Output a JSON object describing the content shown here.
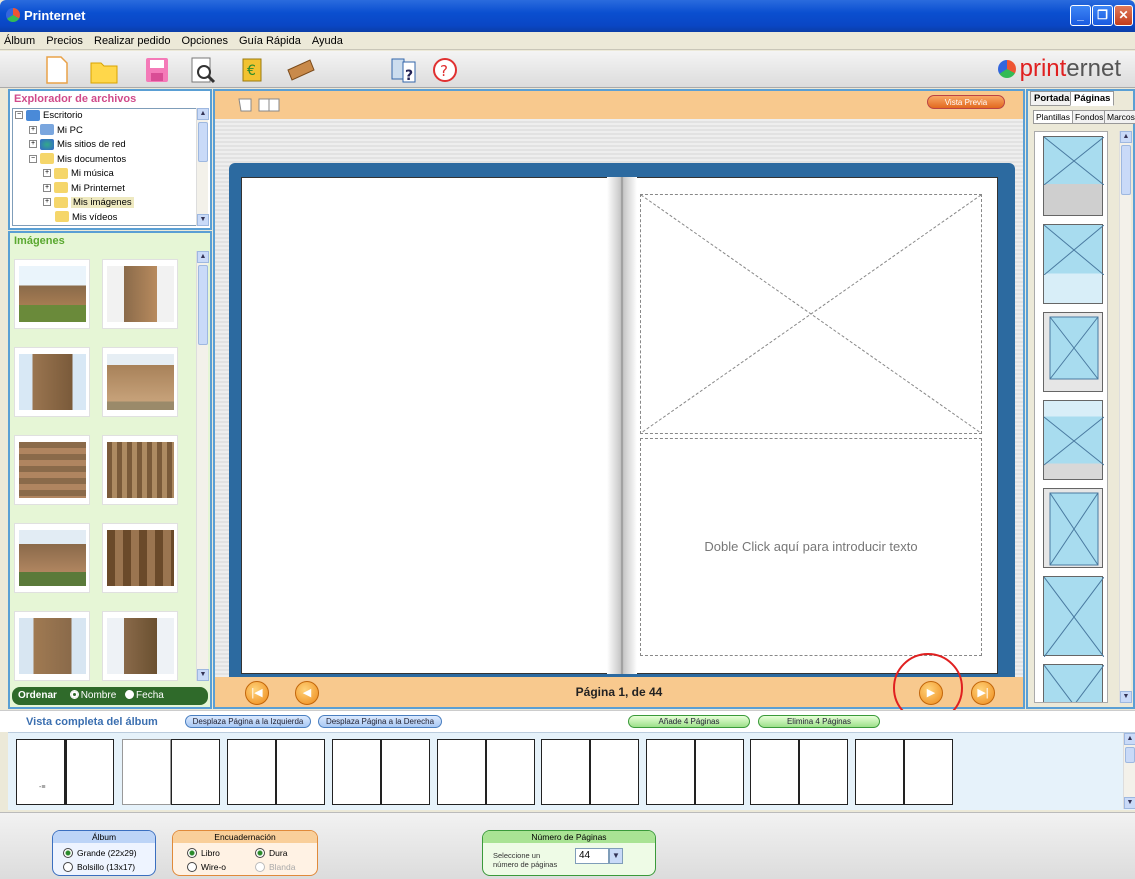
{
  "window": {
    "title": "Printernet"
  },
  "menu": [
    "Álbum",
    "Precios",
    "Realizar pedido",
    "Opciones",
    "Guía Rápida",
    "Ayuda"
  ],
  "toolbar": {
    "icons": [
      "new-document-icon",
      "open-folder-icon",
      "save-icon",
      "print-preview-icon",
      "price-icon",
      "order-icon",
      "quick-guide-icon",
      "help-icon"
    ]
  },
  "logo": {
    "prefix": "print",
    "suffix": "ernet"
  },
  "explorer": {
    "title": "Explorador de archivos",
    "items": [
      {
        "label": "Escritorio"
      },
      {
        "label": "Mi PC"
      },
      {
        "label": "Mis sitios de red"
      },
      {
        "label": "Mis documentos"
      },
      {
        "label": "Mi música"
      },
      {
        "label": "Mi Printernet"
      },
      {
        "label": "Mis imágenes"
      },
      {
        "label": "Mis vídeos"
      }
    ]
  },
  "images_panel": {
    "title": "Imágenes",
    "sort_label": "Ordenar",
    "sort_name": "Nombre",
    "sort_date": "Fecha",
    "thumbnails": 10
  },
  "editor": {
    "preview_button": "Vista Previa",
    "text_placeholder": "Doble Click aquí para introducir texto",
    "page_info": "Página 1, de 44"
  },
  "right_panel": {
    "tabs": [
      "Portada",
      "Páginas"
    ],
    "subtabs": [
      "Plantillas",
      "Fondos",
      "Marcos"
    ]
  },
  "album_strip": {
    "title": "Vista completa del álbum",
    "shift_left": "Desplaza Página a la Izquierda",
    "shift_right": "Desplaza Página a la Derecha",
    "add_pages": "Añade 4 Páginas",
    "remove_pages": "Elimina 4 Páginas"
  },
  "bottom": {
    "album": {
      "title": "Álbum",
      "large": "Grande (22x29)",
      "pocket": "Bolsillo (13x17)"
    },
    "binding": {
      "title": "Encuadernación",
      "book": "Libro",
      "wireo": "Wire-o",
      "hard": "Dura",
      "soft": "Blanda"
    },
    "pages": {
      "title": "Número de Páginas",
      "select_label": "Seleccione un número de páginas",
      "value": "44"
    }
  },
  "colors": {
    "accent_blue": "#5a9fd4",
    "orange": "#f8c98e",
    "green_panel": "#e6f6d6",
    "title_blue": "#0a4fd0"
  }
}
